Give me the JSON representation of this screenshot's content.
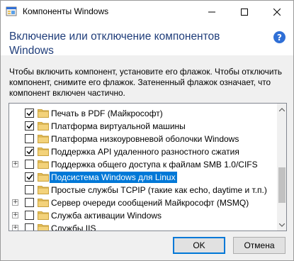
{
  "window": {
    "title": "Компоненты Windows",
    "heading": "Включение или отключение компонентов Windows",
    "description": "Чтобы включить компонент, установите его флажок. Чтобы отключить компонент, снимите его флажок. Затененный флажок означает, что компонент включен частично."
  },
  "features": [
    {
      "label": "Печать в PDF (Майкрософт)",
      "checked": true,
      "expandable": false,
      "selected": false
    },
    {
      "label": "Платформа виртуальной машины",
      "checked": true,
      "expandable": false,
      "selected": false
    },
    {
      "label": "Платформа низкоуровневой оболочки Windows",
      "checked": false,
      "expandable": false,
      "selected": false
    },
    {
      "label": "Поддержка API удаленного разностного сжатия",
      "checked": true,
      "expandable": false,
      "selected": false
    },
    {
      "label": "Поддержка общего доступа к файлам SMB 1.0/CIFS",
      "checked": false,
      "expandable": true,
      "selected": false
    },
    {
      "label": "Подсистема Windows для Linux",
      "checked": true,
      "expandable": false,
      "selected": true
    },
    {
      "label": "Простые службы TCPIP (такие как echo, daytime и т.п.)",
      "checked": false,
      "expandable": false,
      "selected": false
    },
    {
      "label": "Сервер очереди сообщений Майкрософт (MSMQ)",
      "checked": false,
      "expandable": true,
      "selected": false
    },
    {
      "label": "Служба активации Windows",
      "checked": false,
      "expandable": true,
      "selected": false
    },
    {
      "label": "Службы IIS",
      "checked": false,
      "expandable": true,
      "selected": false
    }
  ],
  "buttons": {
    "ok": "OK",
    "cancel": "Отмена"
  },
  "colors": {
    "selection": "#0078d7",
    "folder": "#e8c15a",
    "help": "#2f6fd6"
  }
}
